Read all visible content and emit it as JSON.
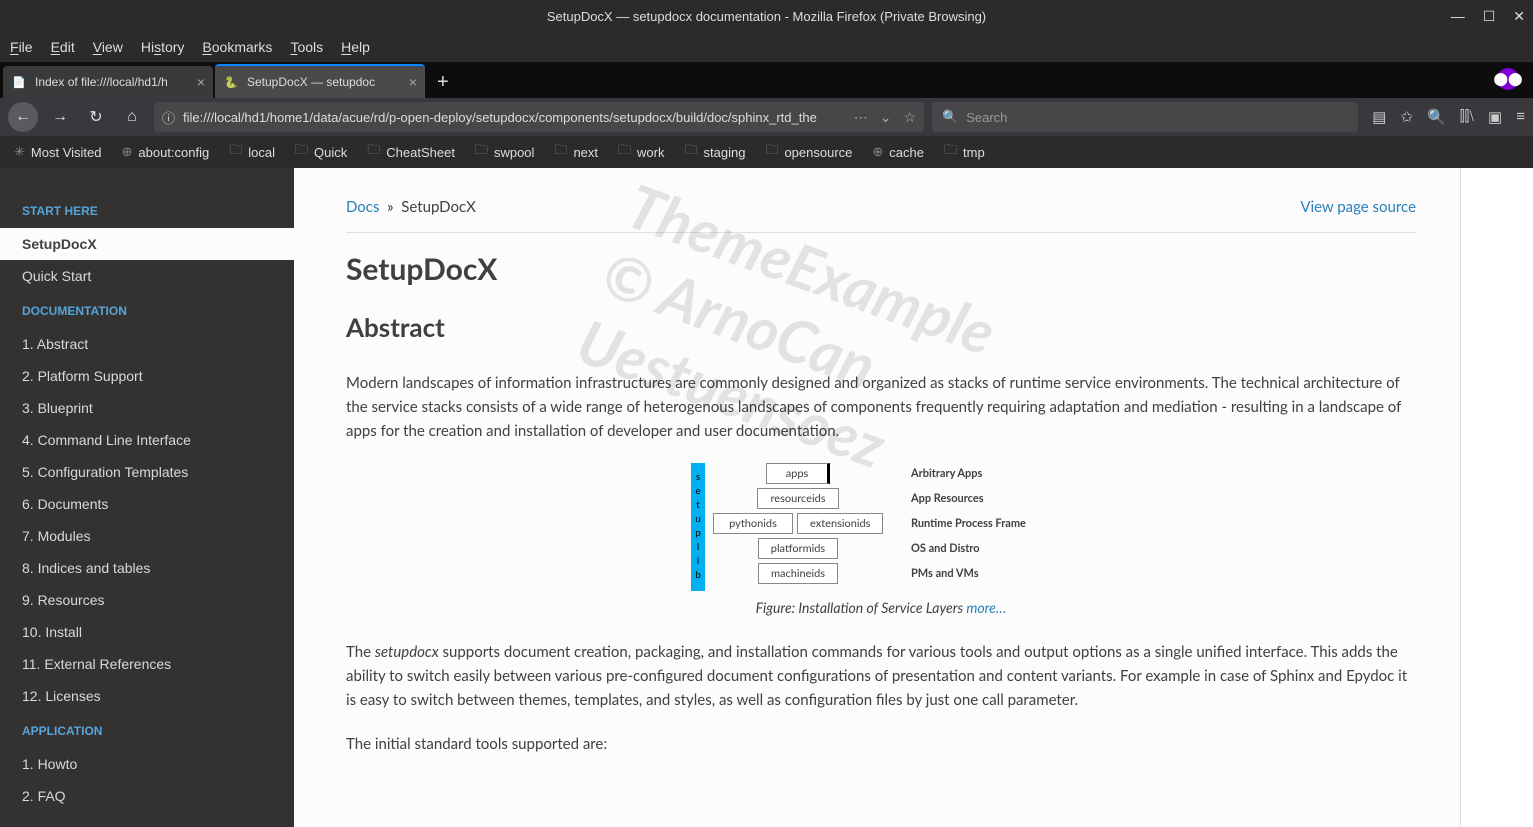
{
  "window": {
    "title": "SetupDocX — setupdocx documentation - Mozilla Firefox (Private Browsing)"
  },
  "menu": [
    "File",
    "Edit",
    "View",
    "History",
    "Bookmarks",
    "Tools",
    "Help"
  ],
  "tabs": [
    {
      "label": "Index of file:///local/hd1/h",
      "active": false
    },
    {
      "label": "SetupDocX — setupdoc",
      "active": true
    }
  ],
  "url": "file:///local/hd1/home1/data/acue/rd/p-open-deploy/setupdocx/components/setupdocx/build/doc/sphinx_rtd_the",
  "search_placeholder": "Search",
  "bookmarks": [
    {
      "icon": "gear",
      "label": "Most Visited"
    },
    {
      "icon": "globe",
      "label": "about:config"
    },
    {
      "icon": "folder",
      "label": "local"
    },
    {
      "icon": "folder",
      "label": "Quick"
    },
    {
      "icon": "folder",
      "label": "CheatSheet"
    },
    {
      "icon": "folder",
      "label": "swpool"
    },
    {
      "icon": "folder",
      "label": "next"
    },
    {
      "icon": "folder",
      "label": "work"
    },
    {
      "icon": "folder",
      "label": "staging"
    },
    {
      "icon": "folder",
      "label": "opensource"
    },
    {
      "icon": "globe",
      "label": "cache"
    },
    {
      "icon": "folder",
      "label": "tmp"
    }
  ],
  "sidebar": {
    "sections": [
      {
        "title": "START HERE",
        "items": [
          {
            "label": "SetupDocX",
            "active": true
          },
          {
            "label": "Quick Start"
          }
        ]
      },
      {
        "title": "DOCUMENTATION",
        "items": [
          {
            "label": "1. Abstract"
          },
          {
            "label": "2. Platform Support"
          },
          {
            "label": "3. Blueprint"
          },
          {
            "label": "4. Command Line Interface"
          },
          {
            "label": "5. Configuration Templates"
          },
          {
            "label": "6. Documents"
          },
          {
            "label": "7. Modules"
          },
          {
            "label": "8. Indices and tables"
          },
          {
            "label": "9. Resources"
          },
          {
            "label": "10. Install"
          },
          {
            "label": "11. External References"
          },
          {
            "label": "12. Licenses"
          }
        ]
      },
      {
        "title": "APPLICATION",
        "items": [
          {
            "label": "1. Howto"
          },
          {
            "label": "2. FAQ"
          }
        ]
      }
    ]
  },
  "doc": {
    "breadcrumb_root": "Docs",
    "breadcrumb_current": "SetupDocX",
    "view_source": "View page source",
    "h1": "SetupDocX",
    "h2": "Abstract",
    "para1": "Modern landscapes of information infrastructures are commonly designed and organized as stacks of runtime service environments. The technical architecture of the service stacks consists of a wide range of heterogenous landscapes of components frequently requiring adaptation and mediation - resulting in a landscape of apps for the creation and installation of developer and user documentation.",
    "diagram": {
      "side": "setuplib",
      "rows": [
        {
          "boxes": [
            "apps"
          ],
          "apps": true,
          "label": "Arbitrary Apps"
        },
        {
          "boxes": [
            "resourceids"
          ],
          "label": "App Resources"
        },
        {
          "boxes": [
            "pythonids",
            "extensionids"
          ],
          "label": "Runtime Process Frame"
        },
        {
          "boxes": [
            "platformids"
          ],
          "label": "OS and Distro"
        },
        {
          "boxes": [
            "machineids"
          ],
          "label": "PMs and VMs"
        }
      ]
    },
    "caption_pre": "Figure: Installation of Service Layers ",
    "caption_link": "more…",
    "para2_pre": "The ",
    "para2_em": "setupdocx",
    "para2_post": " supports document creation, packaging, and installation commands for various tools and output options as a single unified interface. This adds the ability to switch easily between various pre-configured document configurations of presentation and content variants. For example in case of Sphinx and Epydoc it is easy to switch between themes, templates, and styles, as well as configuration files by just one call parameter.",
    "para3": "The initial standard tools supported are:"
  }
}
